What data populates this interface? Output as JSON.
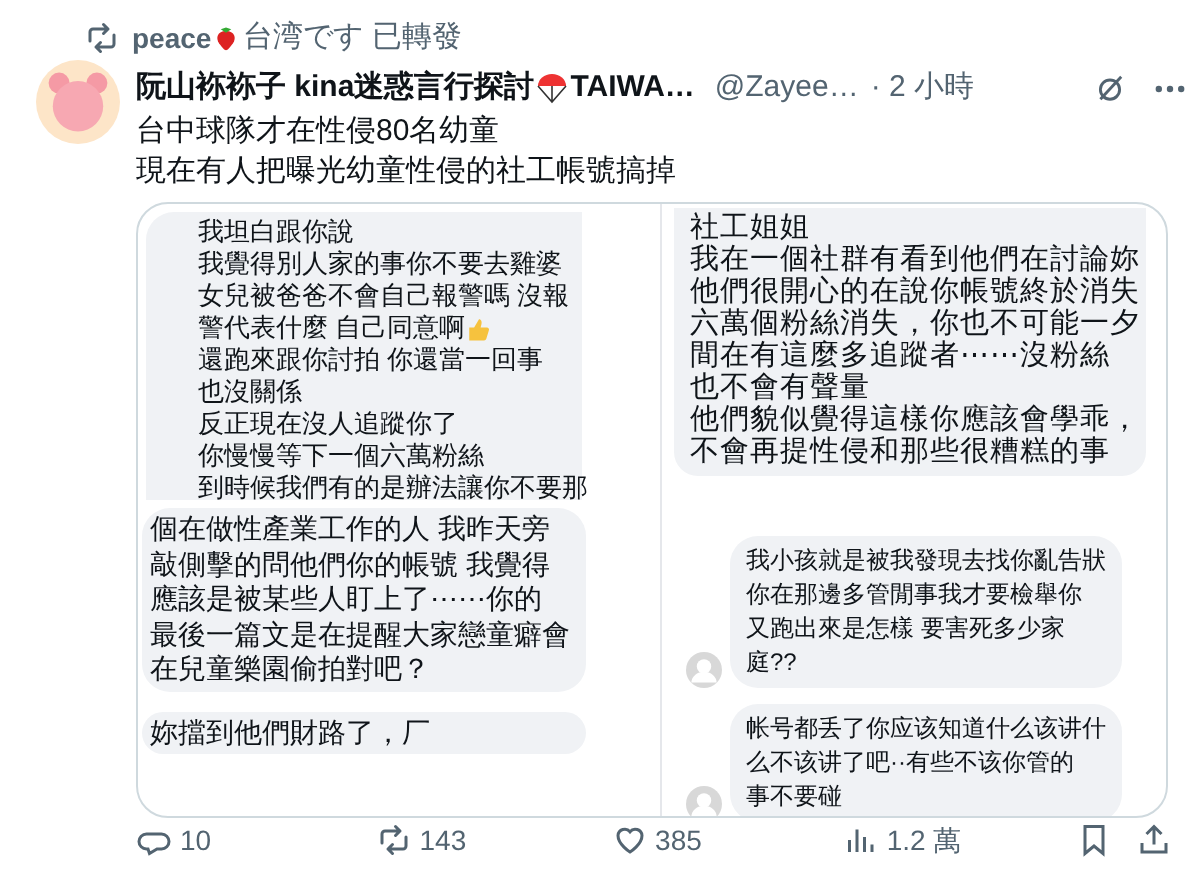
{
  "repost_banner": {
    "user": "peace",
    "text": "台湾です 已轉發"
  },
  "post": {
    "display_name": "阮山袮袮子 kina迷惑言行探討",
    "display_name_tail": "TAIWA…",
    "handle": "@Zayee…",
    "time": "· 2 小時",
    "text_lines": [
      "台中球隊才在性侵80名幼童",
      "現在有人把曝光幼童性侵的社工帳號搞掉"
    ]
  },
  "image": {
    "panels": [
      {
        "messages": [
          {
            "avatar": false,
            "lines": [
              {
                "text": "我坦白跟你說",
                "kind": "plain"
              },
              {
                "text": "我覺得別人家的事你不要去雞婆",
                "kind": "plain"
              },
              {
                "text": "女兒被爸爸不會自己報警嗎 沒報",
                "kind": "plain"
              },
              {
                "text": "警代表什麼 自己同意啊",
                "kind": "thumb"
              },
              {
                "text": "還跑來跟你討拍 你還當一回事",
                "kind": "plain"
              },
              {
                "text": "也沒關係",
                "kind": "plain"
              },
              {
                "text": "反正現在沒人追蹤你了",
                "kind": "plain"
              },
              {
                "text": "你慢慢等下一個六萬粉絲",
                "kind": "plain"
              },
              {
                "text": "到時候我們有的是辦法讓你不要那",
                "kind": "plain"
              }
            ]
          }
        ]
      },
      {
        "messages": [
          {
            "avatar": false,
            "lines": [
              {
                "text": "社工姐姐",
                "kind": "plain"
              },
              {
                "text": "我在一個社群有看到他們在討論妳",
                "kind": "plain"
              },
              {
                "text": "他們很開心的在說你帳號終於消失",
                "kind": "plain"
              },
              {
                "text": "六萬個粉絲消失，你也不可能一夕",
                "kind": "plain"
              },
              {
                "text": "間在有這麼多追蹤者⋯⋯沒粉絲",
                "kind": "plain"
              },
              {
                "text": "也不會有聲量",
                "kind": "plain"
              },
              {
                "text": "他們貌似覺得這樣你應該會學乖，",
                "kind": "plain"
              },
              {
                "text": "不會再提性侵和那些很糟糕的事",
                "kind": "plain"
              }
            ]
          }
        ]
      },
      {
        "messages": [
          {
            "avatar": false,
            "lines": [
              {
                "text": "個在做性產業工作的人 我昨天旁",
                "kind": "plain"
              },
              {
                "text": "敲側擊的問他們你的帳號 我覺得",
                "kind": "plain"
              },
              {
                "text": "應該是被某些人盯上了⋯⋯你的",
                "kind": "plain"
              },
              {
                "text": "最後一篇文是在提醒大家戀童癖會",
                "kind": "plain"
              },
              {
                "text": "在兒童樂園偷拍對吧？",
                "kind": "plain"
              }
            ]
          },
          {
            "avatar": false,
            "lines": [
              {
                "text": "妳擋到他們財路了，厂",
                "kind": "plain"
              }
            ]
          }
        ]
      },
      {
        "messages": [
          {
            "avatar": true,
            "lines": [
              {
                "text": "我小孩就是被我發現去找你亂告狀",
                "kind": "plain"
              },
              {
                "text": "你在那邊多管閒事我才要檢舉你",
                "kind": "plain"
              },
              {
                "text": "又跑出來是怎樣 要害死多少家",
                "kind": "plain"
              },
              {
                "text": "庭??",
                "kind": "plain"
              }
            ]
          },
          {
            "avatar": true,
            "lines": [
              {
                "text": "帐号都丢了你应该知道什么该讲什",
                "kind": "plain"
              },
              {
                "text": "么不该讲了吧··有些不该你管的",
                "kind": "plain"
              },
              {
                "text": "事不要碰",
                "kind": "plain"
              }
            ]
          }
        ]
      }
    ]
  },
  "actions": [
    {
      "kind": "reply",
      "count": "10"
    },
    {
      "kind": "repost",
      "count": "143"
    },
    {
      "kind": "like",
      "count": "385"
    },
    {
      "kind": "views",
      "count": "1.2 萬"
    },
    {
      "kind": "bookmark"
    },
    {
      "kind": "share"
    }
  ]
}
